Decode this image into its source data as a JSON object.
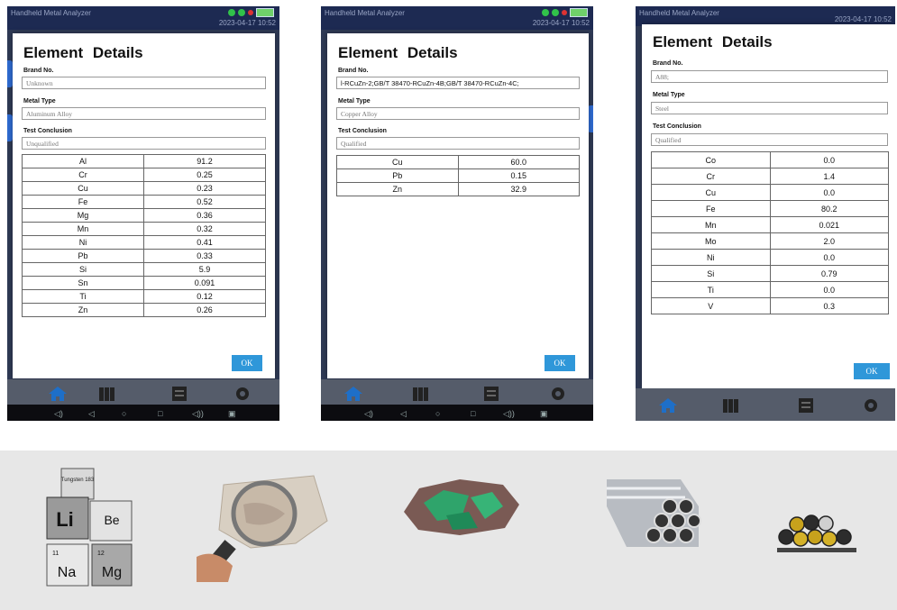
{
  "app": {
    "title": "Handheld Metal Analyzer",
    "datetime": "2023-04-17 10:52"
  },
  "dialog": {
    "title": "Element Details",
    "brand_label": "Brand No.",
    "metal_type_label": "Metal Type",
    "conclusion_label": "Test Conclusion",
    "ok_label": "OK"
  },
  "screens": [
    {
      "brand": "Unknown",
      "metal_type": "Aluminum Alloy",
      "conclusion": "Unqualified",
      "elements": [
        {
          "symbol": "Al",
          "value": "91.2"
        },
        {
          "symbol": "Cr",
          "value": "0.25"
        },
        {
          "symbol": "Cu",
          "value": "0.23"
        },
        {
          "symbol": "Fe",
          "value": "0.52"
        },
        {
          "symbol": "Mg",
          "value": "0.36"
        },
        {
          "symbol": "Mn",
          "value": "0.32"
        },
        {
          "symbol": "Ni",
          "value": "0.41"
        },
        {
          "symbol": "Pb",
          "value": "0.33"
        },
        {
          "symbol": "Si",
          "value": "5.9"
        },
        {
          "symbol": "Sn",
          "value": "0.091"
        },
        {
          "symbol": "Ti",
          "value": "0.12"
        },
        {
          "symbol": "Zn",
          "value": "0.26"
        }
      ]
    },
    {
      "brand": "l-RCuZn-2;GB/T 38470-RCuZn-4B;GB/T 38470-RCuZn-4C;",
      "metal_type": "Copper Alloy",
      "conclusion": "Qualified",
      "elements": [
        {
          "symbol": "Cu",
          "value": "60.0"
        },
        {
          "symbol": "Pb",
          "value": "0.15"
        },
        {
          "symbol": "Zn",
          "value": "32.9"
        }
      ]
    },
    {
      "brand": "A88;",
      "metal_type": "Steel",
      "conclusion": "Qualified",
      "elements": [
        {
          "symbol": "Co",
          "value": "0.0"
        },
        {
          "symbol": "Cr",
          "value": "1.4"
        },
        {
          "symbol": "Cu",
          "value": "0.0"
        },
        {
          "symbol": "Fe",
          "value": "80.2"
        },
        {
          "symbol": "Mn",
          "value": "0.021"
        },
        {
          "symbol": "Mo",
          "value": "2.0"
        },
        {
          "symbol": "Ni",
          "value": "0.0"
        },
        {
          "symbol": "Si",
          "value": "0.79"
        },
        {
          "symbol": "Ti",
          "value": "0.0"
        },
        {
          "symbol": "V",
          "value": "0.3"
        }
      ]
    }
  ],
  "products": {
    "element_cubes": {
      "cube_top": "Tungsten 183",
      "li": "Li",
      "be": "Be",
      "na": "Na",
      "mg": "Mg",
      "n11": "11",
      "n12": "12"
    }
  },
  "icons": [
    "home-icon",
    "library-icon",
    "report-icon",
    "settings-icon",
    "volume-down-icon",
    "back-icon",
    "home-circle-icon",
    "recent-icon",
    "volume-up-icon",
    "screenshot-icon"
  ],
  "colors": {
    "ok_button": "#2f97d9",
    "statusbar": "#1d2a52",
    "bottomnav": "#555c6a"
  }
}
